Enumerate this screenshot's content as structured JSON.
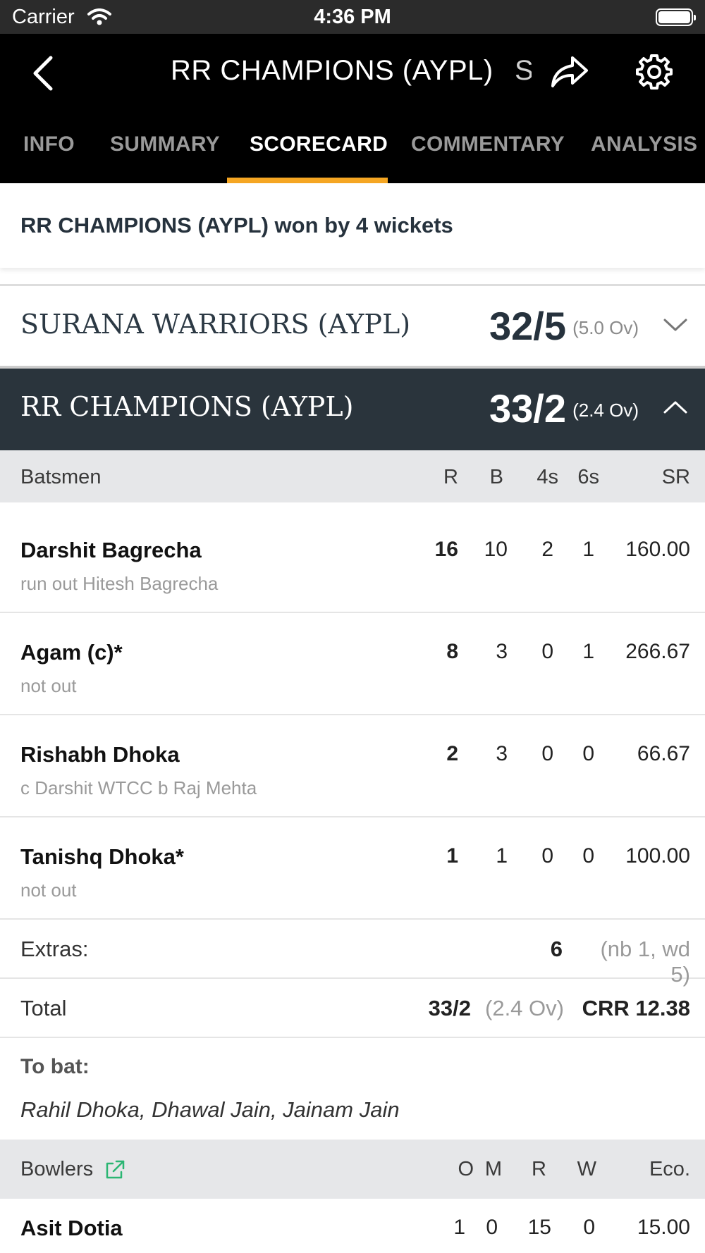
{
  "status_bar": {
    "carrier": "Carrier",
    "time": "4:36 PM"
  },
  "nav": {
    "title": "RR CHAMPIONS (AYPL)",
    "title_peek": "S"
  },
  "tabs": [
    {
      "label": "INFO"
    },
    {
      "label": "SUMMARY"
    },
    {
      "label": "SCORECARD"
    },
    {
      "label": "COMMENTARY"
    },
    {
      "label": "ANALYSIS"
    }
  ],
  "active_tab": "SCORECARD",
  "result": "RR CHAMPIONS (AYPL) won by 4 wickets",
  "innings": [
    {
      "team": "SURANA WARRIORS (AYPL)",
      "score": "32/5",
      "overs": "(5.0 Ov)",
      "expanded": false
    },
    {
      "team": "RR CHAMPIONS (AYPL)",
      "score": "33/2",
      "overs": "(2.4 Ov)",
      "expanded": true
    }
  ],
  "batting_header": {
    "label": "Batsmen",
    "r": "R",
    "b": "B",
    "fours": "4s",
    "sixes": "6s",
    "sr": "SR"
  },
  "batsmen": [
    {
      "name": "Darshit Bagrecha",
      "dismissal": "run out Hitesh Bagrecha",
      "r": "16",
      "b": "10",
      "fours": "2",
      "sixes": "1",
      "sr": "160.00"
    },
    {
      "name": "Agam (c)*",
      "dismissal": "not out",
      "r": "8",
      "b": "3",
      "fours": "0",
      "sixes": "1",
      "sr": "266.67"
    },
    {
      "name": "Rishabh Dhoka",
      "dismissal": "c Darshit WTCC b Raj Mehta",
      "r": "2",
      "b": "3",
      "fours": "0",
      "sixes": "0",
      "sr": "66.67"
    },
    {
      "name": "Tanishq Dhoka*",
      "dismissal": "not out",
      "r": "1",
      "b": "1",
      "fours": "0",
      "sixes": "0",
      "sr": "100.00"
    }
  ],
  "extras": {
    "label": "Extras:",
    "value": "6",
    "detail": "(nb 1, wd 5)"
  },
  "total": {
    "label": "Total",
    "score": "33/2",
    "overs": "(2.4 Ov)",
    "crr": "CRR 12.38"
  },
  "to_bat": {
    "label": "To bat:",
    "players": "Rahil Dhoka, Dhawal Jain, Jainam Jain"
  },
  "bowling_header": {
    "label": "Bowlers",
    "o": "O",
    "m": "M",
    "r": "R",
    "w": "W",
    "eco": "Eco."
  },
  "bowlers": [
    {
      "name": "Asit Dotia",
      "o": "1",
      "m": "0",
      "r": "15",
      "w": "0",
      "eco": "15.00"
    }
  ],
  "colors": {
    "accent": "#f5a623",
    "dark_header": "#2a343c",
    "link_icon": "#2bb673"
  }
}
